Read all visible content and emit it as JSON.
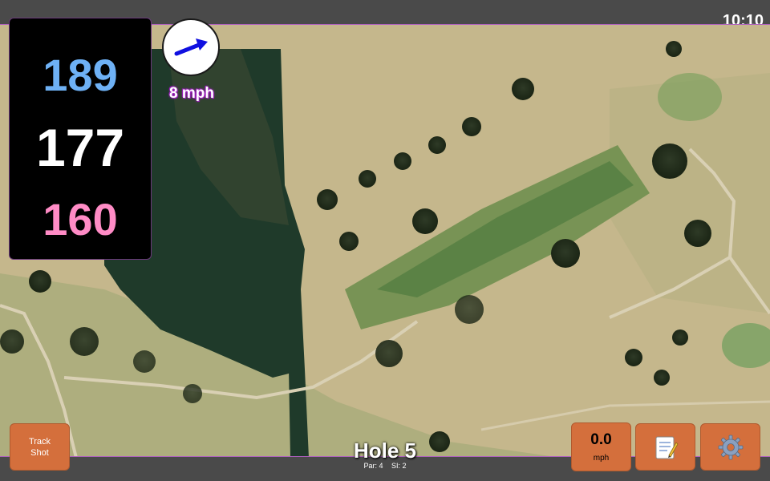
{
  "status": {
    "time": "10:10"
  },
  "yardages": {
    "back": "189",
    "middle": "177",
    "front": "160"
  },
  "wind": {
    "speed_label": "8 mph",
    "readout_value": "0.0",
    "readout_unit": "mph"
  },
  "buttons": {
    "track_shot_line1": "Track",
    "track_shot_line2": "Shot"
  },
  "hole": {
    "title": "Hole 5",
    "par": "Par: 4",
    "si": "SI: 2"
  },
  "icons": {
    "wind_direction": "wind-arrow-icon",
    "notes": "notes-icon",
    "settings": "gear-icon"
  },
  "colors": {
    "back_yardage": "#6eb1f5",
    "middle_yardage": "#ffffff",
    "front_yardage": "#ff8cc6",
    "button": "#d46f3c",
    "wind_text_glow": "#a020c0",
    "arrow": "#1010e0"
  }
}
